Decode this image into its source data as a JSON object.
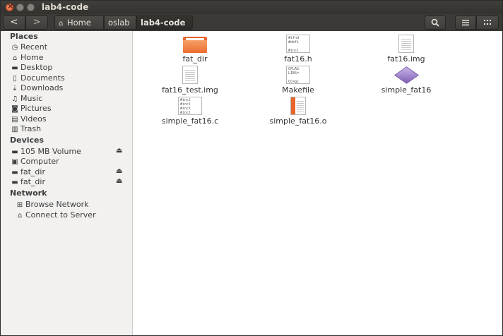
{
  "window": {
    "title": "lab4-code"
  },
  "toolbar": {
    "breadcrumbs": [
      "Home",
      "oslab",
      "lab4-code"
    ]
  },
  "sidebar": {
    "places_header": "Places",
    "places": [
      "Recent",
      "Home",
      "Desktop",
      "Documents",
      "Downloads",
      "Music",
      "Pictures",
      "Videos",
      "Trash"
    ],
    "devices_header": "Devices",
    "devices": [
      "105 MB Volume",
      "Computer",
      "fat_dir",
      "fat_dir"
    ],
    "network_header": "Network",
    "network": [
      "Browse Network",
      "Connect to Server"
    ]
  },
  "files": {
    "fat_dir": "fat_dir",
    "fat16_h": "fat16.h",
    "fat16_img": "fat16.img",
    "fat16_test_img": "fat16_test.img",
    "makefile": "Makefile",
    "simple_fat16": "simple_fat16",
    "simple_fat16_c": "simple_fat16.c",
    "simple_fat16_o": "simple_fat16.o"
  },
  "thumbnails": {
    "fat16_h": [
      "#ifnd",
      "#defi",
      "",
      "#incl"
    ],
    "makefile": [
      "CFLAG",
      "LIBS=",
      "",
      "CC=gc"
    ],
    "simple_fat16_c": [
      "#incl",
      "#incl",
      "#incl",
      "#incl"
    ]
  },
  "colors": {
    "accent": "#e9642b",
    "titlebar": "#3b3a36"
  }
}
